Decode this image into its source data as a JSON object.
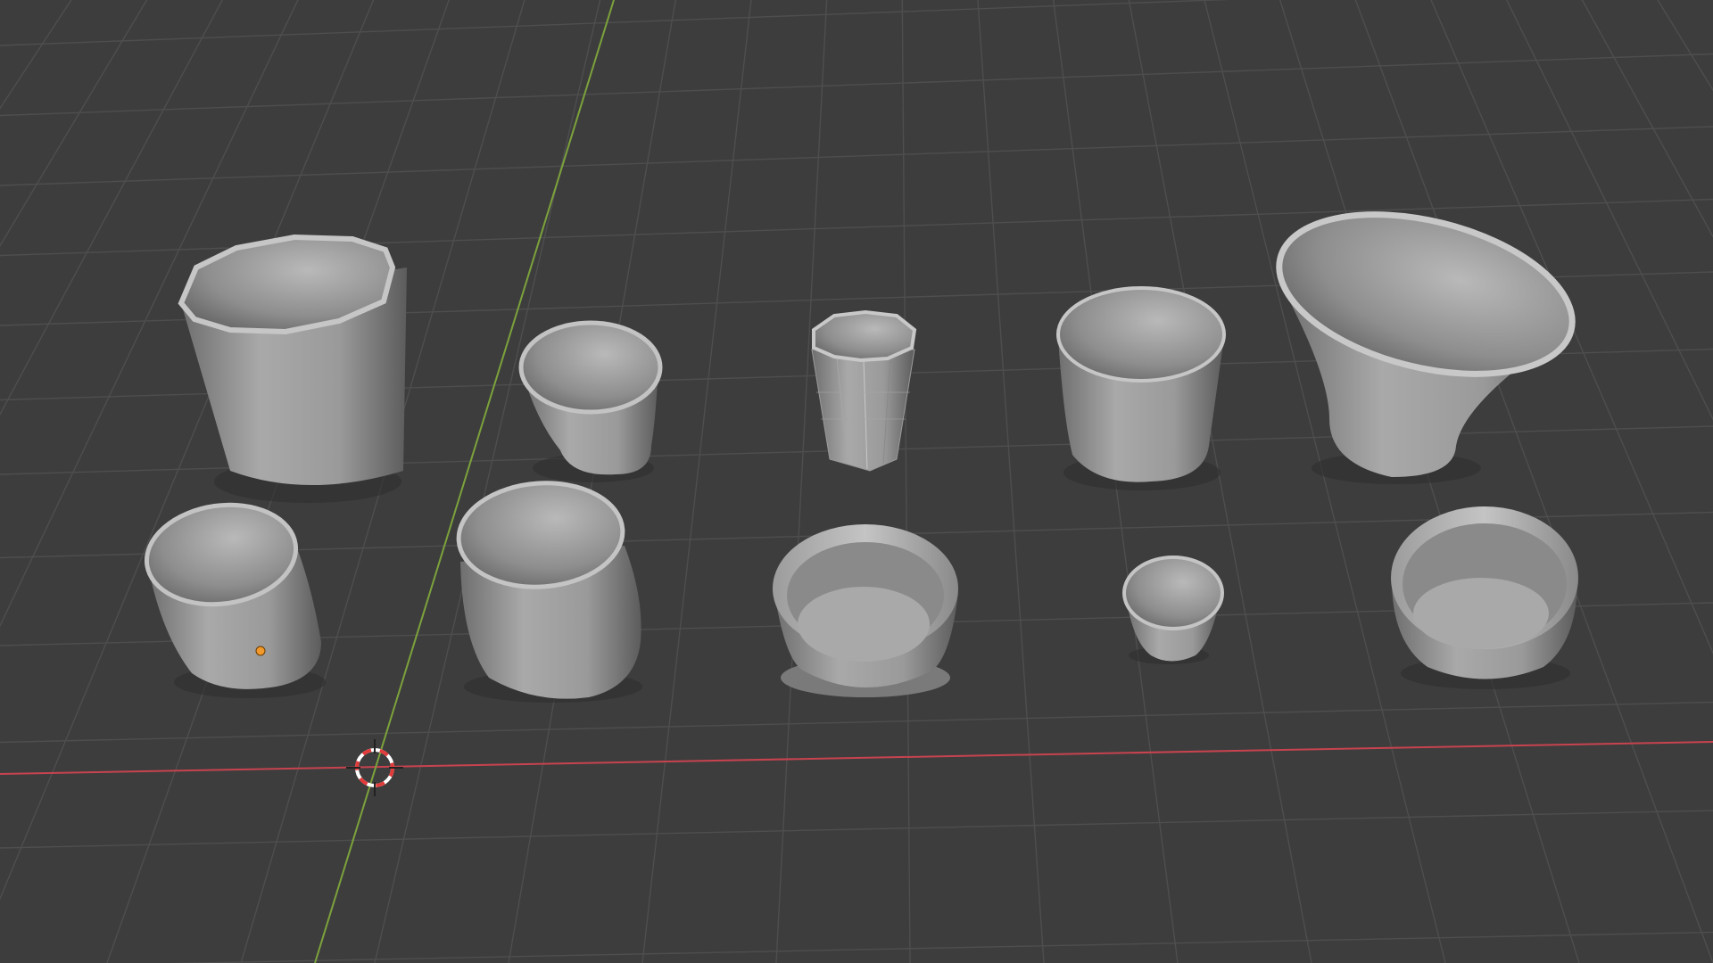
{
  "app": "3D Viewport",
  "colors": {
    "background": "#3d3d3d",
    "grid_line": "#4e4e4e",
    "x_axis": "#c7434f",
    "y_axis": "#7ca23c",
    "mesh_light": "#b8b8b8",
    "mesh_mid": "#8f8f8f",
    "mesh_dark": "#5a5a5a",
    "origin_dot": "#f19a2b",
    "cursor_red": "#e23b3b",
    "cursor_white": "#ffffff"
  },
  "scene": {
    "objects": [
      {
        "name": "tall-faceted-cup"
      },
      {
        "name": "small-tapered-cup"
      },
      {
        "name": "octagonal-tumbler"
      },
      {
        "name": "straight-cup"
      },
      {
        "name": "wide-flared-bowl"
      },
      {
        "name": "selected-small-cup"
      },
      {
        "name": "large-straight-cup"
      },
      {
        "name": "shallow-rimmed-dish"
      },
      {
        "name": "tiny-cup"
      },
      {
        "name": "low-bowl"
      }
    ],
    "selected_object_origin": "visible",
    "show_3d_cursor": true,
    "show_floor_grid": true,
    "show_axes": [
      "X",
      "Y"
    ]
  }
}
